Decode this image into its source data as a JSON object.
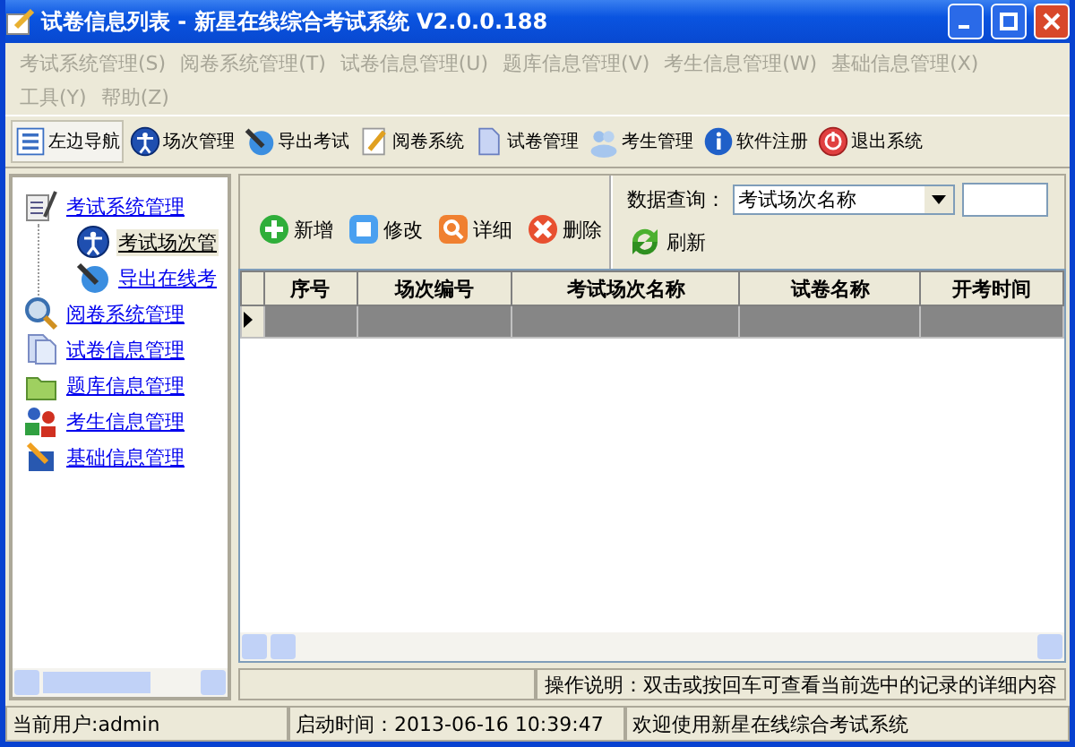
{
  "window": {
    "title": "试卷信息列表 - 新星在线综合考试系统 V2.0.0.188"
  },
  "menu": [
    {
      "label": "考试系统管理(S)",
      "disabled": true
    },
    {
      "label": "阅卷系统管理(T)",
      "disabled": true
    },
    {
      "label": "试卷信息管理(U)",
      "disabled": true
    },
    {
      "label": "题库信息管理(V)",
      "disabled": true
    },
    {
      "label": "考生信息管理(W)",
      "disabled": true
    },
    {
      "label": "基础信息管理(X)",
      "disabled": true
    },
    {
      "label": "工具(Y)",
      "disabled": true
    },
    {
      "label": "帮助(Z)",
      "disabled": true
    }
  ],
  "toolbar": [
    {
      "label": "左边导航",
      "selected": true
    },
    {
      "label": "场次管理",
      "selected": false
    },
    {
      "label": "导出考试",
      "selected": false
    },
    {
      "label": "阅卷系统",
      "selected": false
    },
    {
      "label": "试卷管理",
      "selected": false
    },
    {
      "label": "考生管理",
      "selected": false
    },
    {
      "label": "软件注册",
      "selected": false
    },
    {
      "label": "退出系统",
      "selected": false
    }
  ],
  "tree": [
    {
      "label": "考试系统管理",
      "selected": false,
      "children": [
        {
          "label": "考试场次管",
          "selected": true
        },
        {
          "label": "导出在线考",
          "selected": false
        }
      ]
    },
    {
      "label": "阅卷系统管理",
      "selected": false
    },
    {
      "label": "试卷信息管理",
      "selected": false
    },
    {
      "label": "题库信息管理",
      "selected": false
    },
    {
      "label": "考生信息管理",
      "selected": false
    },
    {
      "label": "基础信息管理",
      "selected": false
    }
  ],
  "actions": [
    {
      "label": "新增"
    },
    {
      "label": "修改"
    },
    {
      "label": "详细"
    },
    {
      "label": "删除"
    }
  ],
  "query": {
    "label": "数据查询：",
    "field": "考试场次名称",
    "refresh": "刷新"
  },
  "table": {
    "columns": [
      "序号",
      "场次编号",
      "考试场次名称",
      "试卷名称",
      "开考时间"
    ],
    "rows": [
      {
        "selected": true
      }
    ]
  },
  "hint": "操作说明：双击或按回车可查看当前选中的记录的详细内容",
  "status_bar": [
    "当前用户:admin",
    "启动时间：2013-06-16 10:39:47",
    "欢迎使用新星在线综合考试系统"
  ]
}
